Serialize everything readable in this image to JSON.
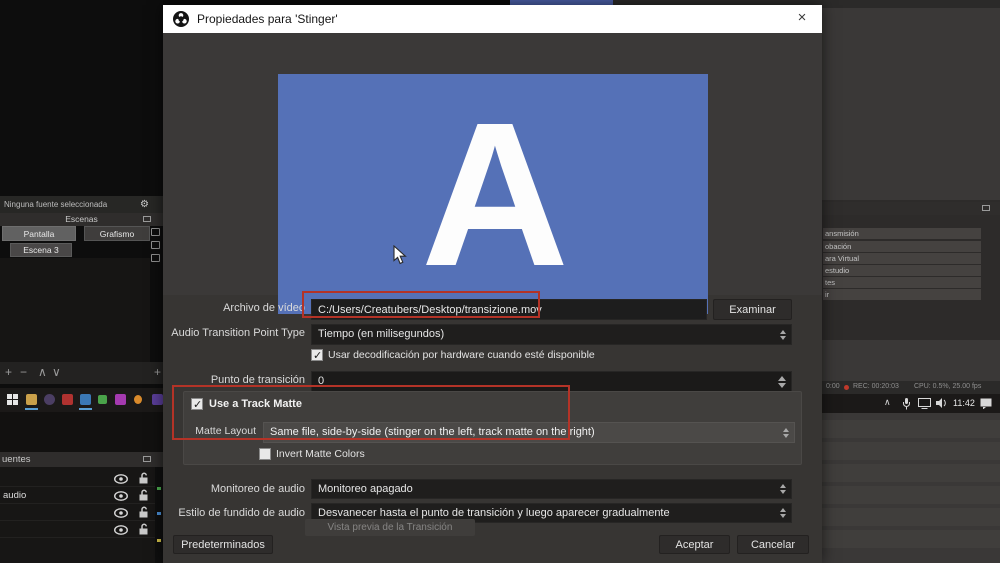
{
  "window": {
    "title": "Propiedades para 'Stinger'",
    "close_glyph": "×"
  },
  "preview": {
    "letter": "A"
  },
  "form": {
    "video_file": {
      "label": "Archivo de vídeo",
      "value": "C:/Users/Creatubers/Desktop/transizione.mov",
      "browse": "Examinar"
    },
    "audio_point_type": {
      "label": "Audio Transition Point Type",
      "value": "Tiempo (en milisegundos)"
    },
    "hw_decode": {
      "label": "Usar decodificación por hardware cuando esté disponible",
      "checked": true
    },
    "transition_point": {
      "label": "Punto de transición",
      "value": "0"
    },
    "track_matte": {
      "label": "Use a Track Matte",
      "checked": true
    },
    "matte_layout": {
      "label": "Matte Layout",
      "value": "Same file, side-by-side (stinger on the left, track matte on the right)"
    },
    "invert_matte": {
      "label": "Invert Matte Colors",
      "checked": false
    },
    "audio_monitoring": {
      "label": "Monitoreo de audio",
      "value": "Monitoreo apagado"
    },
    "audio_fade": {
      "label": "Estilo de fundido de audio",
      "value": "Desvanecer hasta el punto de transición y luego aparecer gradualmente"
    },
    "preview_transition": {
      "label": "Vista previa de la Transición"
    }
  },
  "footer": {
    "defaults": "Predeterminados",
    "ok": "Aceptar",
    "cancel": "Cancelar"
  },
  "background": {
    "left": {
      "no_source_bar": "Ninguna fuente seleccionada",
      "scenes_header": "Escenas",
      "scenes": [
        "Pantalla",
        "Grafismo",
        "Escena 3"
      ],
      "toolbar": [
        "+",
        "−",
        "∧",
        "∨"
      ],
      "add_glyph": "+",
      "sources_header": "uentes",
      "source_label": "audio"
    },
    "right": {
      "control_fragments": [
        "ansmisión",
        "obación",
        "ara Virtual",
        "estudio",
        "tes",
        "ir"
      ],
      "stream_fragment": "0:00",
      "rec_status": "REC: 00:20:03",
      "cpu_status": "CPU: 0.5%, 25.00 fps",
      "tray_time": "11:42"
    }
  },
  "colors": {
    "annotation_red": "#b43327",
    "preview_blue": "#5571b7",
    "titlebar_bg": "#ffffff",
    "dialog_bg": "#373533",
    "field_bg": "#1d1d1d",
    "taskbar_bg": "#1b1918"
  }
}
